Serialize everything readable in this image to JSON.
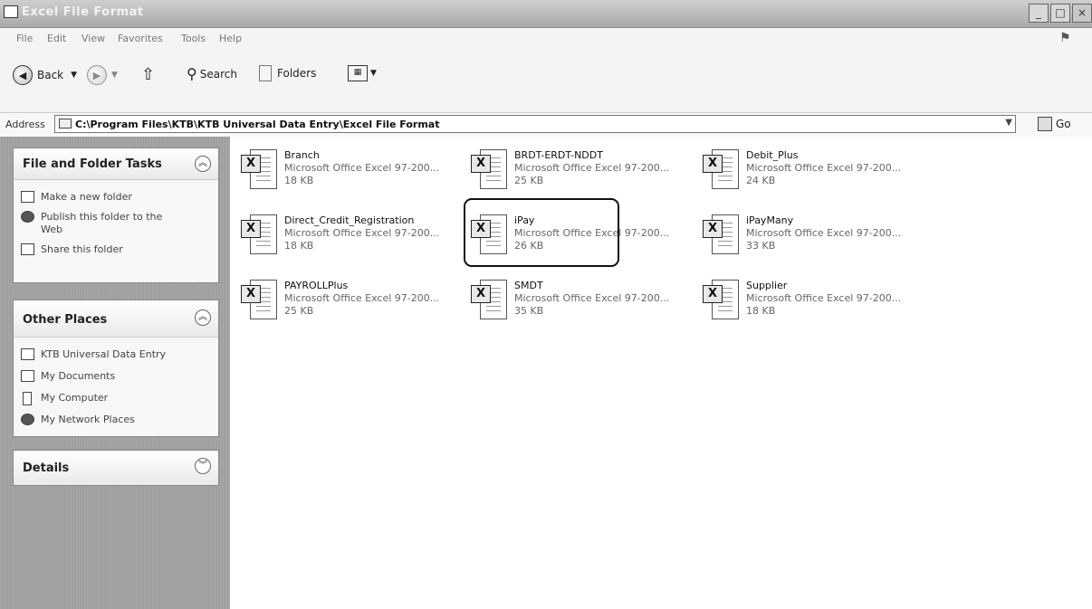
{
  "window": {
    "title": "Excel File Format",
    "buttons": [
      "_",
      "□",
      "×"
    ]
  },
  "menu": [
    "File",
    "Edit",
    "View",
    "Favorites",
    "Tools",
    "Help"
  ],
  "toolbar": {
    "back_label": "Back",
    "search_label": "Search",
    "folders_label": "Folders"
  },
  "address": {
    "label": "Address",
    "path": "C:\\Program Files\\KTB\\KTB Universal Data Entry\\Excel File Format",
    "go_label": "Go"
  },
  "sidebar": {
    "file_tasks": {
      "title": "File and Folder Tasks",
      "items": [
        "Make a new folder",
        "Publish this folder to the Web",
        "Share this folder"
      ]
    },
    "other_places": {
      "title": "Other Places",
      "items": [
        "KTB Universal Data Entry",
        "My Documents",
        "My Computer",
        "My Network Places"
      ]
    },
    "details": {
      "title": "Details"
    }
  },
  "files": [
    {
      "name": "Branch",
      "type": "Microsoft Office Excel 97-200...",
      "size": "18 KB"
    },
    {
      "name": "BRDT-ERDT-NDDT",
      "type": "Microsoft Office Excel 97-200...",
      "size": "25 KB"
    },
    {
      "name": "Debit_Plus",
      "type": "Microsoft Office Excel 97-200...",
      "size": "24 KB"
    },
    {
      "name": "Direct_Credit_Registration",
      "type": "Microsoft Office Excel 97-200...",
      "size": "18 KB"
    },
    {
      "name": "iPay",
      "type": "Microsoft Office Excel 97-200...",
      "size": "26 KB"
    },
    {
      "name": "iPayMany",
      "type": "Microsoft Office Excel 97-200...",
      "size": "33 KB"
    },
    {
      "name": "PAYROLLPlus",
      "type": "Microsoft Office Excel 97-200...",
      "size": "25 KB"
    },
    {
      "name": "SMDT",
      "type": "Microsoft Office Excel 97-200...",
      "size": "35 KB"
    },
    {
      "name": "Supplier",
      "type": "Microsoft Office Excel 97-200...",
      "size": "18 KB"
    }
  ]
}
